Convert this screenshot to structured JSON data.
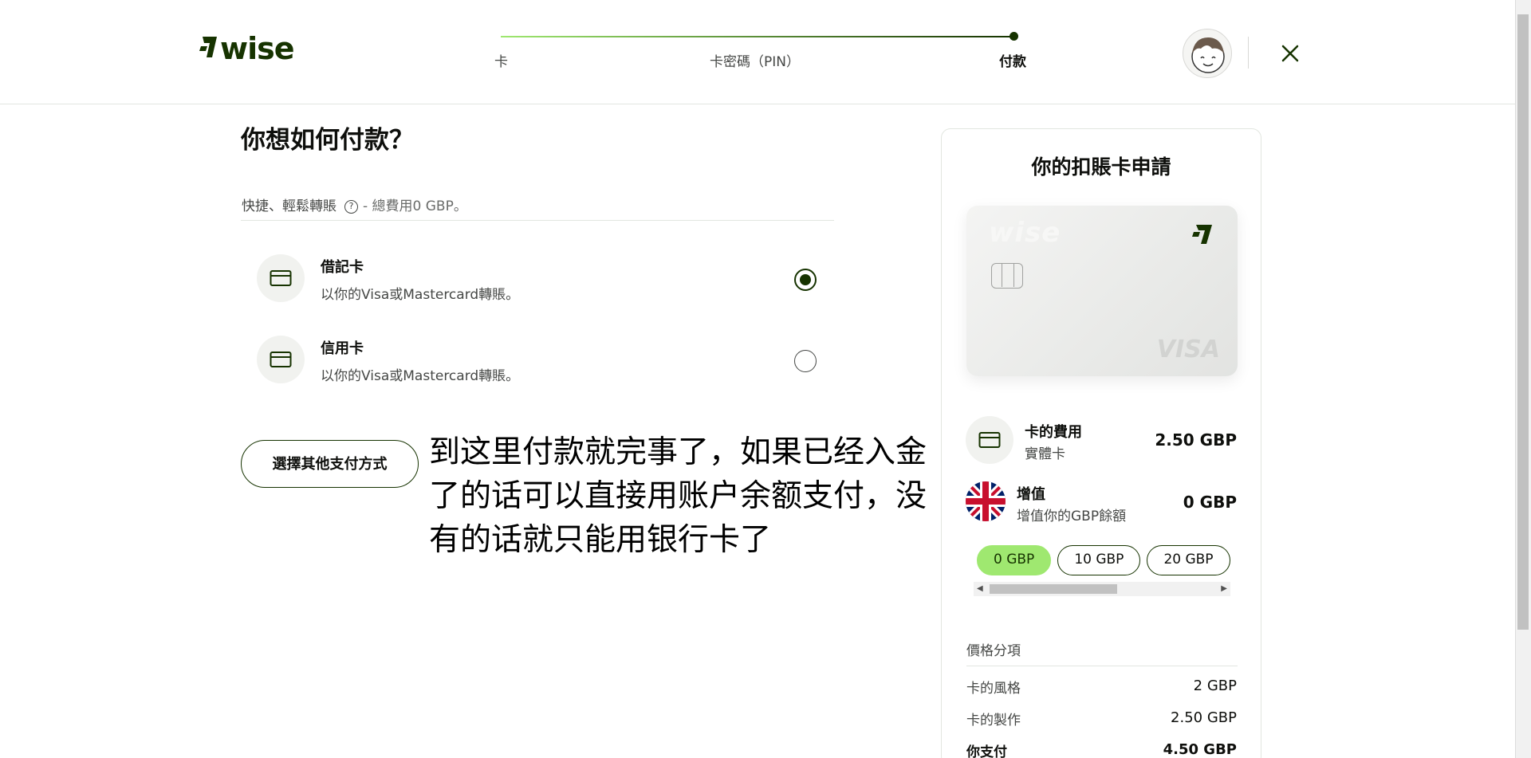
{
  "header": {
    "steps": [
      "卡",
      "卡密碼（PIN）",
      "付款"
    ],
    "current_step": 3,
    "progress": 1.0
  },
  "main": {
    "title": "你想如何付款？",
    "fee_label": "快捷、輕鬆轉賬",
    "fee_note": "- 總費用0 GBP。",
    "options": [
      {
        "title": "借記卡",
        "subtitle": "以你的Visa或Mastercard轉賬。",
        "selected": true
      },
      {
        "title": "信用卡",
        "subtitle": "以你的Visa或Mastercard轉賬。",
        "selected": false
      }
    ],
    "other_button": "選擇其他支付方式",
    "annotation": "到这里付款就完事了，如果已经入金了的话可以直接用账户余额支付，没有的话就只能用银行卡了"
  },
  "summary": {
    "title": "你的扣賬卡申請",
    "card_brand": "VISA",
    "card_wordmark": "wise",
    "card_fee": {
      "title": "卡的費用",
      "subtitle": "實體卡",
      "value": "2.50 GBP"
    },
    "topup": {
      "title": "增值",
      "subtitle": "增值你的GBP餘額",
      "value": "0 GBP"
    },
    "amounts": [
      "0 GBP",
      "10 GBP",
      "20 GBP"
    ],
    "selected_amount": "0 GBP",
    "breakdown_title": "價格分項",
    "breakdown": [
      {
        "label": "卡的風格",
        "value": "2 GBP"
      },
      {
        "label": "卡的製作",
        "value": "2.50 GBP"
      },
      {
        "label": "你支付",
        "value": "4.50 GBP"
      }
    ]
  },
  "colors": {
    "brand_green": "#9fe870",
    "forest_green": "#163300",
    "text": "#0e0f0c"
  },
  "icons": [
    "wise-logo-icon",
    "avatar-icon",
    "close-icon",
    "card-icon",
    "help-icon",
    "uk-flag-icon"
  ]
}
